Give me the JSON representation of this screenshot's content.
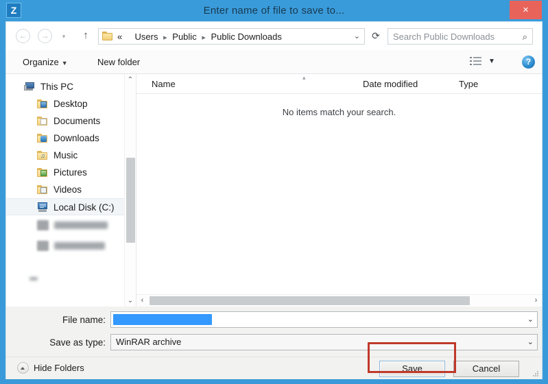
{
  "window": {
    "title": "Enter name of file to save to...",
    "app_icon_letter": "Z",
    "close_label": "×",
    "accent_color": "#3a9bda",
    "close_color": "#e8635a",
    "annotation_color": "#c0392b"
  },
  "nav": {
    "back_glyph": "←",
    "forward_glyph": "→",
    "recent_glyph": "▾",
    "up_glyph": "↑",
    "refresh_glyph": "⟳",
    "dropdown_glyph": "⌄",
    "breadcrumb": {
      "prefix": "«",
      "items": [
        "Users",
        "Public",
        "Public Downloads"
      ],
      "separator": "▸"
    },
    "search": {
      "placeholder": "Search Public Downloads",
      "icon": "⌕"
    }
  },
  "toolbar": {
    "organize_label": "Organize",
    "organize_caret": "▼",
    "new_folder_label": "New folder",
    "view_caret": "▼",
    "help_label": "?"
  },
  "sidebar": {
    "items": [
      {
        "label": "This PC",
        "icon": "computer-icon",
        "indent": 28,
        "selected": false,
        "blurred": false
      },
      {
        "label": "Desktop",
        "icon": "folder-icon",
        "indent": 46,
        "selected": false,
        "blurred": false
      },
      {
        "label": "Documents",
        "icon": "folder-icon",
        "indent": 46,
        "selected": false,
        "blurred": false
      },
      {
        "label": "Downloads",
        "icon": "folder-icon",
        "indent": 46,
        "selected": false,
        "blurred": false
      },
      {
        "label": "Music",
        "icon": "folder-icon",
        "indent": 46,
        "selected": false,
        "blurred": false
      },
      {
        "label": "Pictures",
        "icon": "folder-icon",
        "indent": 46,
        "selected": false,
        "blurred": false
      },
      {
        "label": "Videos",
        "icon": "folder-icon",
        "indent": 46,
        "selected": false,
        "blurred": false
      },
      {
        "label": "Local Disk (C:)",
        "icon": "drive-icon",
        "indent": 46,
        "selected": true,
        "blurred": false
      },
      {
        "label": "",
        "icon": "drive-icon",
        "indent": 46,
        "selected": false,
        "blurred": true
      },
      {
        "label": "",
        "icon": "drive-icon",
        "indent": 46,
        "selected": false,
        "blurred": true
      }
    ],
    "scroll_up_glyph": "⌃",
    "scroll_down_glyph": "⌄"
  },
  "filelist": {
    "columns": [
      "Name",
      "Date modified",
      "Type"
    ],
    "sort_mark": "▴",
    "rows": [],
    "empty_message": "No items match your search.",
    "scroll_left_glyph": "‹",
    "scroll_right_glyph": "›"
  },
  "form": {
    "file_name_label": "File name:",
    "file_name_value": "",
    "file_name_redacted": true,
    "save_type_label": "Save as type:",
    "save_type_value": "WinRAR archive",
    "dropdown_glyph": "⌄"
  },
  "footer": {
    "hide_folders_label": "Hide Folders",
    "save_label": "Save",
    "cancel_label": "Cancel"
  }
}
